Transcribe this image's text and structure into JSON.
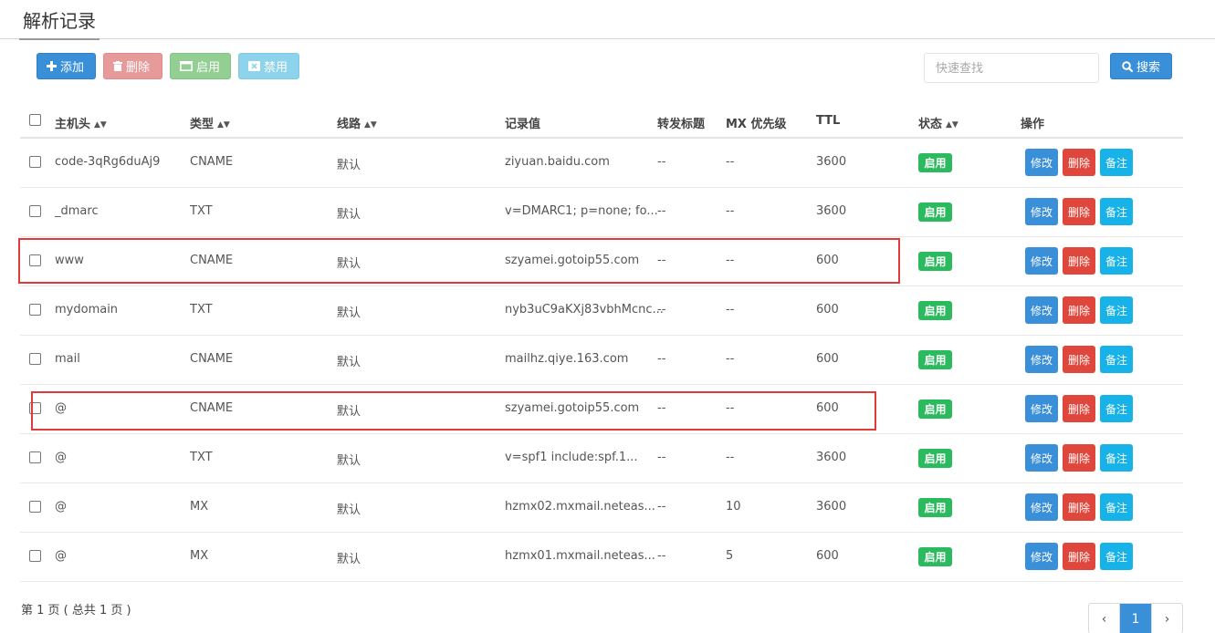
{
  "page": {
    "title": "解析记录"
  },
  "toolbar": {
    "add_label": "添加",
    "delete_label": "删除",
    "enable_label": "启用",
    "disable_label": "禁用"
  },
  "search": {
    "placeholder": "快速查找",
    "button_label": "搜索"
  },
  "table": {
    "headers": {
      "host": "主机头",
      "type": "类型",
      "line": "线路",
      "value": "记录值",
      "fwd_title": "转发标题",
      "mx": "MX 优先级",
      "ttl": "TTL",
      "status": "状态",
      "ops": "操作"
    },
    "rows": [
      {
        "host": "code-3qRg6duAj9",
        "type": "CNAME",
        "line": "默认",
        "value": "ziyuan.baidu.com",
        "fwd_title": "--",
        "mx": "--",
        "ttl": "3600",
        "status": "启用"
      },
      {
        "host": "_dmarc",
        "type": "TXT",
        "line": "默认",
        "value": "v=DMARC1; p=none; fo...",
        "fwd_title": "--",
        "mx": "--",
        "ttl": "3600",
        "status": "启用"
      },
      {
        "host": "www",
        "type": "CNAME",
        "line": "默认",
        "value": "szyamei.gotoip55.com",
        "fwd_title": "--",
        "mx": "--",
        "ttl": "600",
        "status": "启用"
      },
      {
        "host": "mydomain",
        "type": "TXT",
        "line": "默认",
        "value": "nyb3uC9aKXj83vbhMcnc...",
        "fwd_title": "--",
        "mx": "--",
        "ttl": "600",
        "status": "启用"
      },
      {
        "host": "mail",
        "type": "CNAME",
        "line": "默认",
        "value": "mailhz.qiye.163.com",
        "fwd_title": "--",
        "mx": "--",
        "ttl": "600",
        "status": "启用"
      },
      {
        "host": "@",
        "type": "CNAME",
        "line": "默认",
        "value": "szyamei.gotoip55.com",
        "fwd_title": "--",
        "mx": "--",
        "ttl": "600",
        "status": "启用"
      },
      {
        "host": "@",
        "type": "TXT",
        "line": "默认",
        "value": "v=spf1 include:spf.1...",
        "fwd_title": "--",
        "mx": "--",
        "ttl": "3600",
        "status": "启用"
      },
      {
        "host": "@",
        "type": "MX",
        "line": "默认",
        "value": "hzmx02.mxmail.neteas...",
        "fwd_title": "--",
        "mx": "10",
        "ttl": "3600",
        "status": "启用"
      },
      {
        "host": "@",
        "type": "MX",
        "line": "默认",
        "value": "hzmx01.mxmail.neteas...",
        "fwd_title": "--",
        "mx": "5",
        "ttl": "600",
        "status": "启用"
      }
    ],
    "actions": {
      "edit": "修改",
      "delete": "删除",
      "note": "备注"
    }
  },
  "pagination": {
    "info": "第 1 页 ( 总共 1 页 )",
    "current": "1",
    "prev": "‹",
    "next": "›"
  },
  "colors": {
    "primary": "#3a8fd9",
    "danger": "#e0473c",
    "success": "#2bbb5e",
    "info": "#16b2e8",
    "highlight": "#e03a3a"
  },
  "icons": {
    "add": "plus-icon",
    "delete": "trash-icon",
    "enable": "window-icon",
    "disable": "close-box-icon",
    "search": "magnifier-icon",
    "sort": "sort-icon"
  }
}
